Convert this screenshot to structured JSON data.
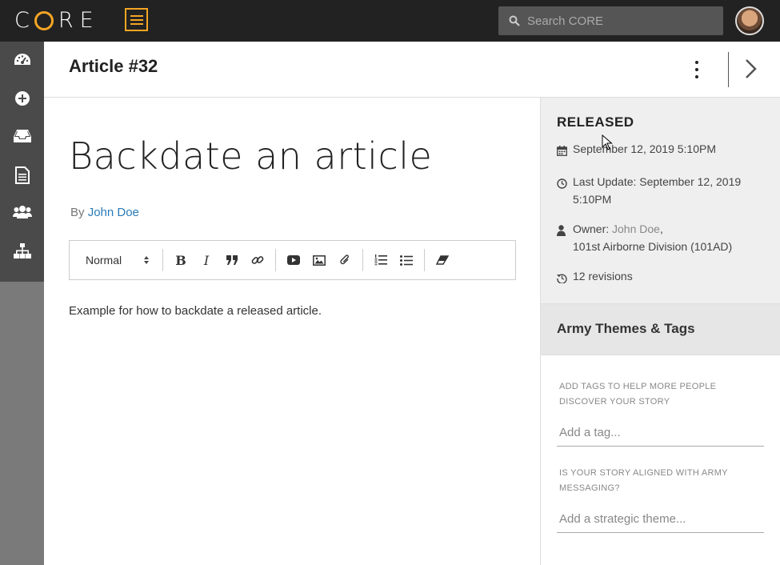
{
  "app": {
    "logo": "CORE"
  },
  "search": {
    "placeholder": "Search CORE"
  },
  "sidebar": {
    "items": [
      {
        "name": "dashboard-icon"
      },
      {
        "name": "add-icon"
      },
      {
        "name": "inbox-icon"
      },
      {
        "name": "document-icon"
      },
      {
        "name": "users-icon"
      },
      {
        "name": "org-chart-icon"
      }
    ]
  },
  "header": {
    "title": "Article #32"
  },
  "article": {
    "title": "Backdate an article",
    "by_label": "By",
    "author": "John Doe",
    "body": "Example for how to backdate a released article."
  },
  "editor": {
    "format_select": "Normal",
    "tools": [
      "bold-icon",
      "italic-icon",
      "quote-icon",
      "link-icon",
      "video-icon",
      "image-icon",
      "attachment-icon",
      "ordered-list-icon",
      "bullet-list-icon",
      "clear-format-icon"
    ]
  },
  "panel": {
    "status": "RELEASED",
    "published": "September 12, 2019 5:10PM",
    "last_update": "Last Update: September 12, 2019 5:10PM",
    "owner_label": "Owner:",
    "owner_name": "John Doe",
    "owner_unit": "101st Airborne Division (101AD)",
    "revisions": "12 revisions",
    "themes_title": "Army Themes & Tags",
    "tags_help": "ADD TAGS TO HELP MORE PEOPLE DISCOVER YOUR STORY",
    "tags_placeholder": "Add a tag...",
    "theme_help": "IS YOUR STORY ALIGNED WITH ARMY MESSAGING?",
    "theme_placeholder": "Add a strategic theme..."
  },
  "colors": {
    "accent": "#f5a623",
    "topbar": "#222222",
    "link": "#2a7ab8"
  }
}
